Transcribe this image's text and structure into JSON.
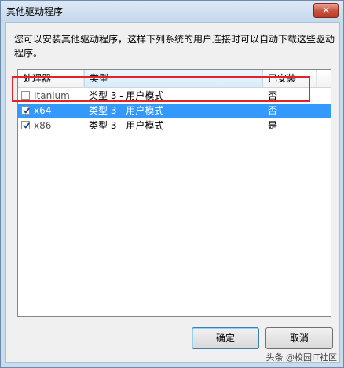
{
  "window": {
    "title": "其他驱动程序",
    "close_glyph": "✕"
  },
  "description": "您可以安装其他驱动程序，这样下列系统的用户连接时可以自动下载这些驱动程序。",
  "table": {
    "columns": [
      "处理器",
      "类型",
      "已安装"
    ],
    "rows": [
      {
        "checked": false,
        "processor": "Itanium",
        "type": "类型 3 - 用户模式",
        "installed": "否",
        "selected": false
      },
      {
        "checked": true,
        "processor": "x64",
        "type": "类型 3 - 用户模式",
        "installed": "否",
        "selected": true
      },
      {
        "checked": true,
        "processor": "x86",
        "type": "类型 3 - 用户模式",
        "installed": "是",
        "selected": false
      }
    ]
  },
  "buttons": {
    "ok_label": "确定",
    "cancel_label": "取消"
  },
  "watermark": "头条 @校园IT社区",
  "colors": {
    "selection": "#3399ff",
    "highlight_border": "#e0242a"
  }
}
